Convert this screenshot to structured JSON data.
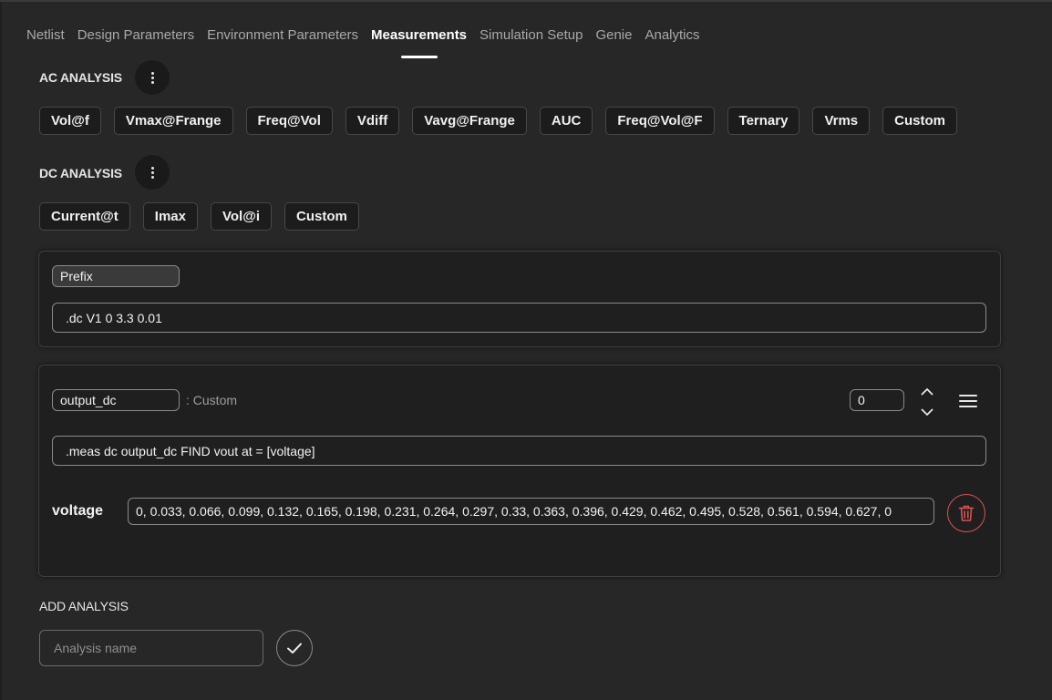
{
  "tabs": [
    {
      "label": "Netlist",
      "active": false
    },
    {
      "label": "Design Parameters",
      "active": false
    },
    {
      "label": "Environment Parameters",
      "active": false
    },
    {
      "label": "Measurements",
      "active": true
    },
    {
      "label": "Simulation Setup",
      "active": false
    },
    {
      "label": "Genie",
      "active": false
    },
    {
      "label": "Analytics",
      "active": false
    }
  ],
  "ac_analysis": {
    "title": "AC ANALYSIS",
    "more_icon": "more-vertical-icon",
    "chips": [
      "Vol@f",
      "Vmax@Frange",
      "Freq@Vol",
      "Vdiff",
      "Vavg@Frange",
      "AUC",
      "Freq@Vol@F",
      "Ternary",
      "Vrms",
      "Custom"
    ]
  },
  "dc_analysis": {
    "title": "DC ANALYSIS",
    "more_icon": "more-vertical-icon",
    "chips": [
      "Current@t",
      "Imax",
      "Vol@i",
      "Custom"
    ]
  },
  "prefix_card": {
    "label": "Prefix",
    "command": ".dc V1 0 3.3 0.01"
  },
  "measurement_card": {
    "name": "output_dc",
    "type_label": ": Custom",
    "order_value": "0",
    "command": ".meas dc output_dc FIND vout at = [voltage]",
    "param_label": "voltage",
    "param_value": "0, 0.033, 0.066, 0.099, 0.132, 0.165, 0.198, 0.231, 0.264, 0.297, 0.33, 0.363, 0.396, 0.429, 0.462, 0.495, 0.528, 0.561, 0.594, 0.627, 0",
    "delete_color": "#d9534f"
  },
  "add_analysis": {
    "title": "ADD ANALYSIS",
    "placeholder": "Analysis name"
  },
  "colors": {
    "background": "#272727",
    "card": "#1f1f1f",
    "danger": "#d9534f"
  }
}
